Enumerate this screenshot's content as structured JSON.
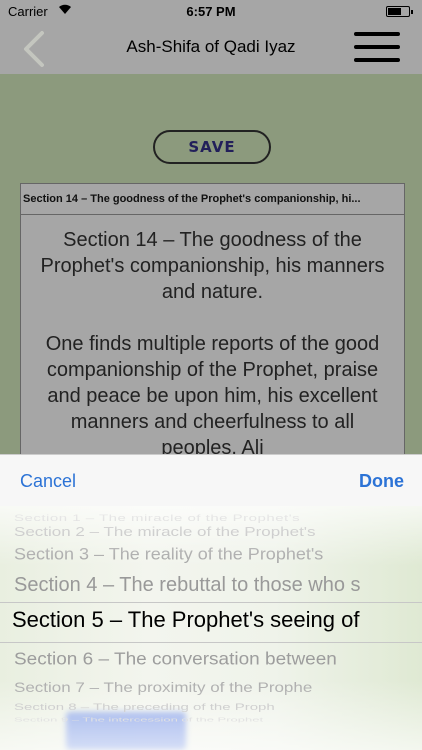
{
  "status_bar": {
    "carrier": "Carrier",
    "time": "6:57 PM"
  },
  "nav": {
    "title": "Ash-Shifa of Qadi Iyaz"
  },
  "content": {
    "save_label": "SAVE",
    "section_header": "Section 14 – The goodness of the Prophet's companionship, hi...",
    "body_title": "Section 14 – The goodness of the Prophet's companionship, his manners and nature.",
    "body_text": "One finds multiple reports of the good companionship of the Prophet, praise and peace be upon him, his excellent manners and cheerfulness to all peoples. Ali"
  },
  "picker": {
    "cancel_label": "Cancel",
    "done_label": "Done",
    "options": [
      "Section 1 – The miracle of the Prophet's",
      "Section 2 – The miracle of the Prophet's",
      "Section 3 – The reality of the Prophet's",
      "Section 4 – The rebuttal to those who s",
      "Section 5 – The Prophet's seeing of",
      "Section 6 – The conversation between",
      "Section 7 – The proximity of the Prophe",
      "Section 8 – The preceding of the Proph",
      "Section 9 – The intercession of the Prophet"
    ],
    "selected_index": 4
  },
  "colors": {
    "accent": "#2c73d6",
    "save_text": "#221f5a"
  },
  "icons": {
    "back": "chevron-left-icon",
    "menu": "hamburger-menu-icon",
    "wifi": "wifi-icon",
    "battery": "battery-icon"
  }
}
